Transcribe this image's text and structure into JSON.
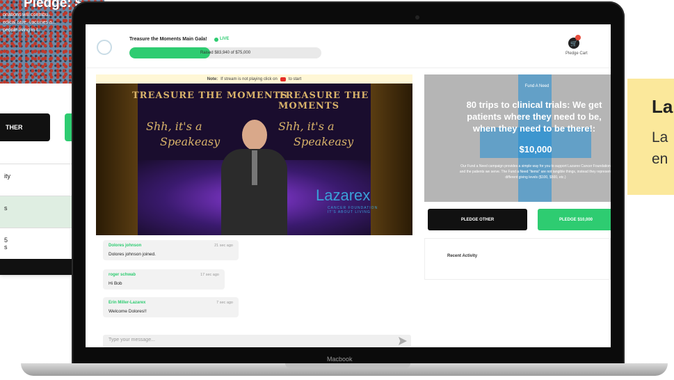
{
  "background_page": {
    "title": "Pledge: $",
    "description": "onations will contribu...\nedical care, vaccines a...\npeople living in t...",
    "pledge_other_label": "THER",
    "list_items": [
      "ity",
      "s",
      "5\ns"
    ]
  },
  "event": {
    "title": "Treasure the Moments Main Gala!",
    "live_label": "LIVE",
    "raised_text": "Raised $83,940 of $75,000",
    "progress_fraction": 0.42,
    "cart_label": "Pledge Cart"
  },
  "note": {
    "prefix": "Note:",
    "text": "If stream is not playing click on",
    "suffix": "to start"
  },
  "video": {
    "banner_left": "TREASURE THE MOMENTS",
    "banner_right": "TREASURE THE MOMENTS",
    "script_left_1": "Shh, it's a",
    "script_left_2": "Speakeasy",
    "script_right_1": "Shh, it's a",
    "script_right_2": "Speakeasy",
    "sponsor_name": "Lazarex",
    "sponsor_sub": "CANCER FOUNDATION\nIT'S ABOUT LIVING"
  },
  "chat": {
    "messages": [
      {
        "name": "Dolores johnson",
        "time": "21 sec ago",
        "text": "Dolores johnson joined."
      },
      {
        "name": "roger schwab",
        "time": "17 sec ago",
        "text": "Hi Bob"
      },
      {
        "name": "Erin Miller-Lazarex",
        "time": "7 sec ago",
        "text": "Welcome Dolores!!"
      }
    ],
    "input_placeholder": "Type your message..."
  },
  "fund": {
    "label": "Fund A Need",
    "title": "80 trips to clinical trials: We get patients where they need to be, when they need to be there!:",
    "amount": "$10,000",
    "description": "Our Fund a Need campaign provides a simple way for you to support Lazarex Cancer Foundation and the patients we serve. The Fund a Need \"items\" are not tangible things, instead they represent different giving levels ($100, $500, etc.)"
  },
  "buttons": {
    "pledge_other": "PLEDGE OTHER",
    "pledge_amount": "PLEDGE $10,000"
  },
  "recent_activity": {
    "label": "Recent Activity"
  },
  "laptop": {
    "brand": "Macbook"
  },
  "promo": {
    "title": "La",
    "body": "La\nen"
  }
}
